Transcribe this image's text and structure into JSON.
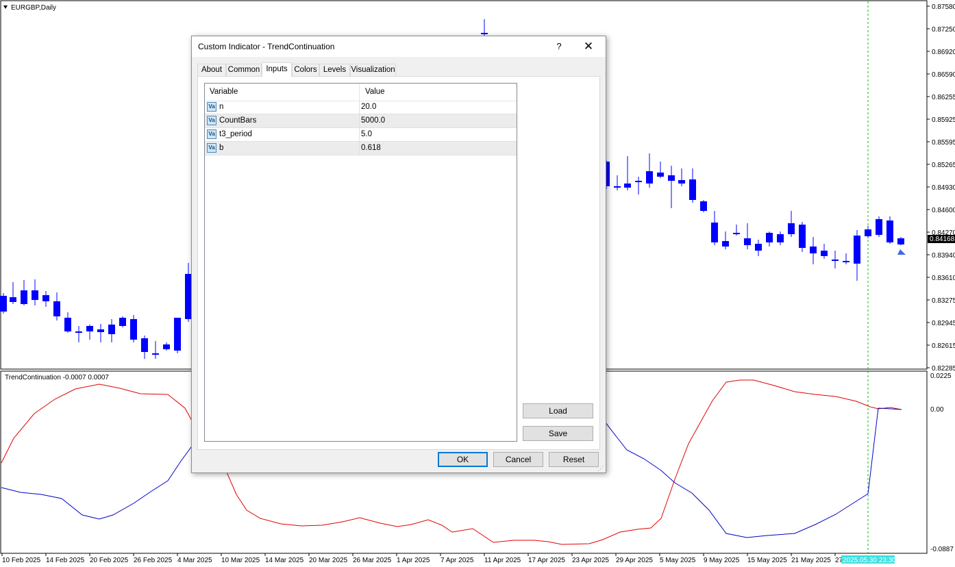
{
  "chart": {
    "symbol_label": "EURGBP,Daily",
    "price_axis": [
      "0.87580",
      "0.87250",
      "0.86920",
      "0.86590",
      "0.86255",
      "0.85925",
      "0.85595",
      "0.85265",
      "0.84930",
      "0.84600",
      "0.84270",
      "0.83940",
      "0.83610",
      "0.83275",
      "0.82945",
      "0.82615",
      "0.82285"
    ],
    "current_price": "0.84168",
    "date_axis": [
      "10 Feb 2025",
      "14 Feb 2025",
      "20 Feb 2025",
      "26 Feb 2025",
      "4 Mar 2025",
      "10 Mar 2025",
      "14 Mar 2025",
      "20 Mar 2025",
      "26 Mar 2025",
      "1 Apr 2025",
      "7 Apr 2025",
      "11 Apr 2025",
      "17 Apr 2025",
      "23 Apr 2025",
      "29 Apr 2025",
      "5 May 2025",
      "9 May 2025",
      "15 May 2025",
      "21 May 2025",
      "27 May 2025"
    ],
    "crosshair_time": "2025.05.30 23:30",
    "colors": {
      "bull": "#ff4500",
      "bear": "#0000ff",
      "line_red": "#e00000",
      "line_blue": "#0000c8",
      "crosshair": "#00c000"
    }
  },
  "indicator": {
    "label": "TrendContinuation -0.0007 0.0007",
    "axis": [
      "0.0225",
      "0.00",
      "-0.0887"
    ]
  },
  "dialog": {
    "title": "Custom Indicator - TrendContinuation",
    "help": "?",
    "close": "✕",
    "tabs": [
      "About",
      "Common",
      "Inputs",
      "Colors",
      "Levels",
      "Visualization"
    ],
    "active_tab": "Inputs",
    "grid": {
      "headers": [
        "Variable",
        "Value"
      ],
      "icon_text": "Va",
      "rows": [
        {
          "variable": "n",
          "value": "20.0"
        },
        {
          "variable": "CountBars",
          "value": "5000.0"
        },
        {
          "variable": "t3_period",
          "value": "5.0"
        },
        {
          "variable": "b",
          "value": "0.618"
        }
      ]
    },
    "buttons": {
      "load": "Load",
      "save": "Save",
      "ok": "OK",
      "cancel": "Cancel",
      "reset": "Reset"
    }
  }
}
